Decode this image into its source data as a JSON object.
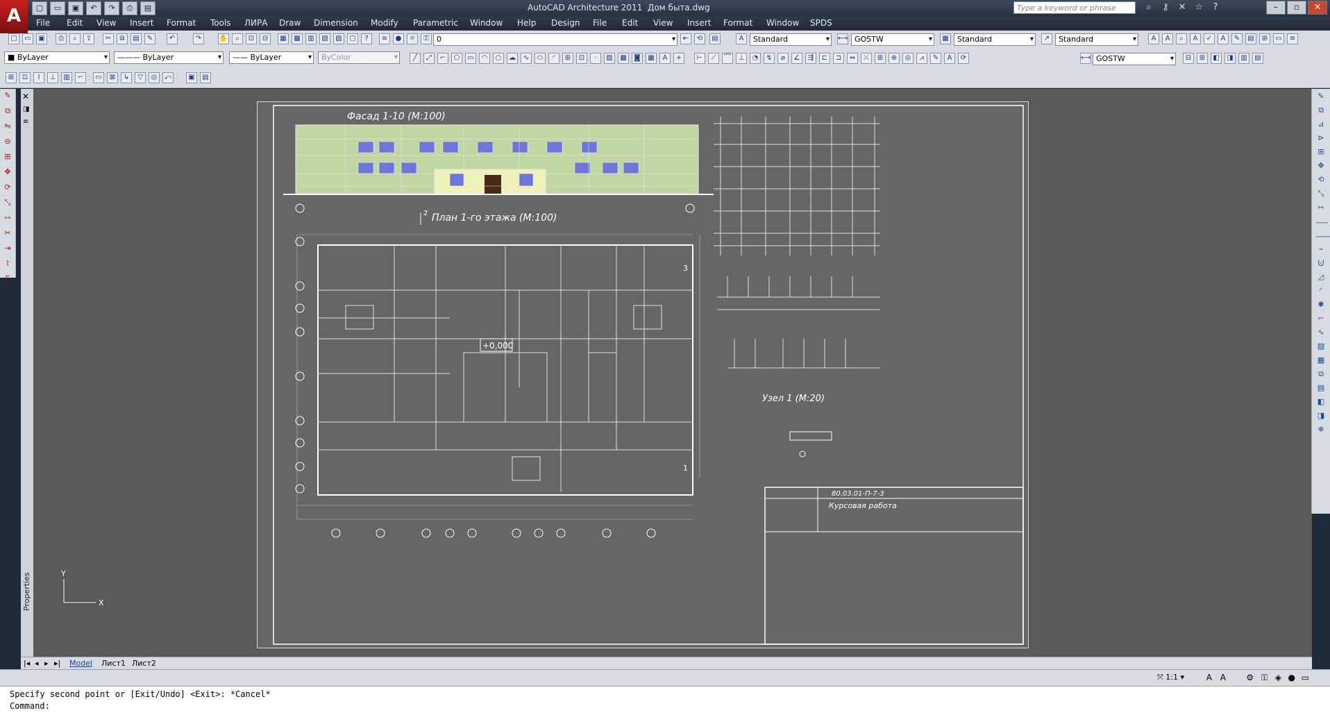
{
  "title_bar": {
    "app_name": "AutoCAD Architecture 2011",
    "file_name": "Дом быта.dwg",
    "search_placeholder": "Type a keyword or phrase"
  },
  "menu": [
    "File",
    "Edit",
    "View",
    "Insert",
    "Format",
    "Tools",
    "ЛИРА",
    "Draw",
    "Dimension",
    "Modify",
    "Parametric",
    "Window",
    "Help",
    "Design",
    "File",
    "Edit",
    "View",
    "Insert",
    "Format",
    "Window",
    "SPDS"
  ],
  "toolbar_row1": {
    "layer_value": "0",
    "text_style": "Standard",
    "dim_style": "GOSTW",
    "table_style": "Standard",
    "multileader_style": "Standard"
  },
  "toolbar_row2": {
    "color": "ByLayer",
    "linetype": "ByLayer",
    "lineweight": "ByLayer",
    "plot_style": "ByColor",
    "dim_style2": "GOSTW"
  },
  "drawing": {
    "facade_title": "Фасад 1-10  (М:100)",
    "plan_title": "План 1-го этажа (М:100)",
    "level_mark": "+0,000",
    "node_title": "Узел 1 (М:20)",
    "stamp_code": "80.03.01-П-7-3",
    "stamp_title": "Курсовая работа",
    "section_label": "2",
    "axis_right_3": "3",
    "axis_right_1": "1"
  },
  "tabs": [
    "Model",
    "Лист1",
    "Лист2"
  ],
  "side_palette": "Properties",
  "ucs": {
    "x": "X",
    "y": "Y"
  },
  "status": {
    "scale": "1:1"
  },
  "command": {
    "history": "Specify second point or [Exit/Undo] <Exit>: *Cancel*",
    "prompt": "Command:"
  }
}
